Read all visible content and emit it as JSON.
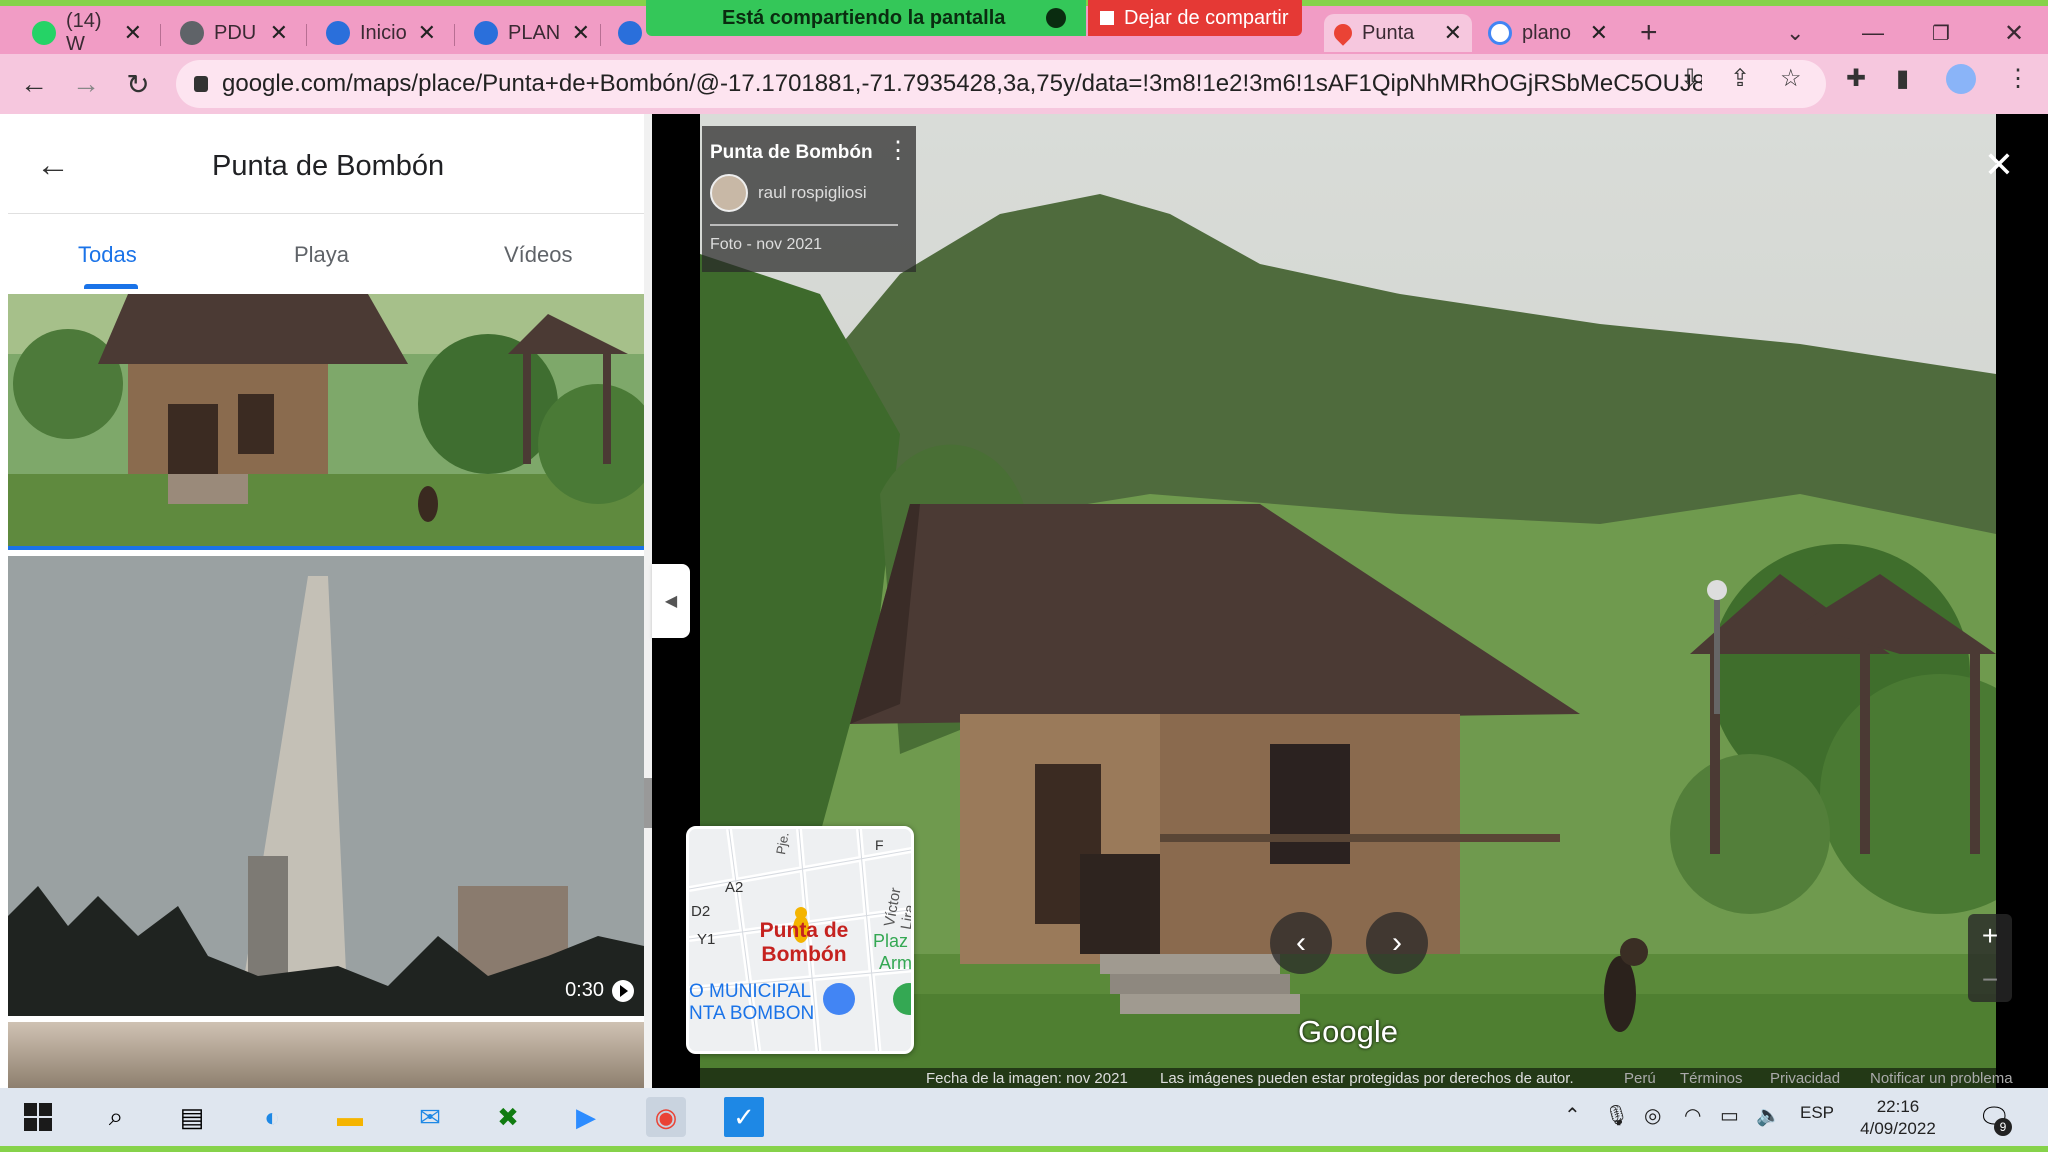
{
  "browser": {
    "tabs": [
      {
        "label": "(14) W",
        "color": "#25d366"
      },
      {
        "label": "PDU",
        "color": "#5f6368"
      },
      {
        "label": "Inicio",
        "color": "#2a6fdb"
      },
      {
        "label": "PLAN",
        "color": "#2a6fdb"
      },
      {
        "label": "",
        "color": "#2a6fdb"
      },
      {
        "label": "Punta",
        "color": "#ea4335"
      },
      {
        "label": "plano",
        "color": "#4285f4"
      }
    ],
    "new_tab": "+",
    "url": "google.com/maps/place/Punta+de+Bombón/@-17.1701881,-71.7935428,3a,75y/data=!3m8!1e2!3m6!1sAF1QipNhMRhOGjRSbMeC5OUJ81vOS..."
  },
  "share": {
    "banner": "Está compartiendo la pantalla",
    "stop": "Dejar de compartir"
  },
  "panel": {
    "title": "Punta de Bombón",
    "tabs": [
      "Todas",
      "Playa",
      "Vídeos"
    ],
    "video_duration": "0:30"
  },
  "viewer": {
    "place": "Punta de Bombón",
    "author": "raul rospigliosi",
    "date": "Foto - nov 2021",
    "brand": "Google",
    "zoom_in": "+",
    "zoom_out": "−",
    "minimap": {
      "labels": [
        "A2",
        "D2",
        "Y1",
        "F",
        "Pje. Ran",
        "Víctor Lira",
        "Plaz",
        "Arm"
      ],
      "place": "Punta de Bombón",
      "municipal": "O MUNICIPAL",
      "municipal2": "NTA BOMBON"
    },
    "footer": {
      "date": "Fecha de la imagen: nov 2021",
      "copyright": "Las imágenes pueden estar protegidas por derechos de autor.",
      "country": "Perú",
      "terms": "Términos",
      "privacy": "Privacidad",
      "report": "Notificar un problema"
    }
  },
  "taskbar": {
    "lang": "ESP",
    "time": "22:16",
    "date": "4/09/2022",
    "notifications": "9"
  }
}
